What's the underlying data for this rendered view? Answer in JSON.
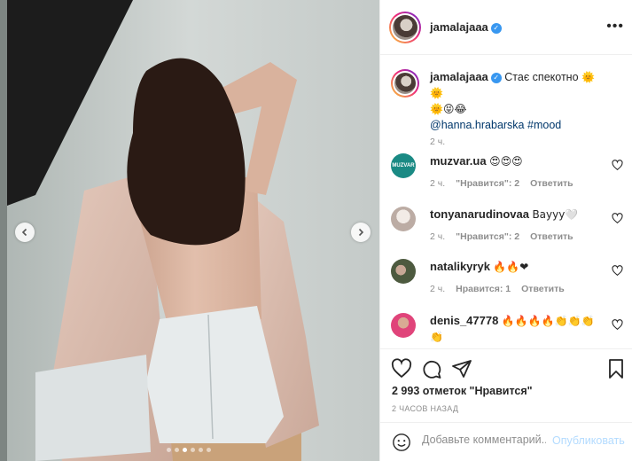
{
  "post": {
    "author": "jamalajaaa",
    "caption_text": "Стає спекотно",
    "caption_emoji_line1": "🌞🌞",
    "caption_emoji_line2": "🌞😝😂",
    "caption_mention": "@hanna.hrabarska",
    "caption_tag": "#mood",
    "caption_time": "2 ч.",
    "likes": "2 993 отметок \"Нравится\"",
    "time_ago": "2 ЧАСОВ НАЗАД",
    "carousel": {
      "total": 6,
      "active": 2
    }
  },
  "header": {
    "more_icon": "more-horizontal-icon"
  },
  "comments": [
    {
      "user": "muzvar.ua",
      "text": "😍😍😍",
      "time": "2 ч.",
      "likes": "\"Нравится\": 2",
      "reply": "Ответить"
    },
    {
      "user": "tonyanarudinovaa",
      "text": "Вayyy🤍",
      "time": "2 ч.",
      "likes": "\"Нравится\": 2",
      "reply": "Ответить"
    },
    {
      "user": "natalikyryk",
      "text": "🔥🔥❤",
      "time": "2 ч.",
      "likes": "Нравится: 1",
      "reply": "Ответить"
    },
    {
      "user": "denis_47778",
      "text": "🔥🔥🔥🔥👏👏👏",
      "text2": "👏",
      "time": "",
      "likes": "",
      "reply": ""
    }
  ],
  "muzvar_avatar_text": "MUZVAR",
  "comment_box": {
    "placeholder": "Добавьте комментарий...",
    "publish": "Опубликовать"
  },
  "colors": {
    "accent": "#3897f0",
    "link": "#00376b",
    "publish_disabled": "#b3dbff",
    "muzvar": "#1a8a84"
  }
}
